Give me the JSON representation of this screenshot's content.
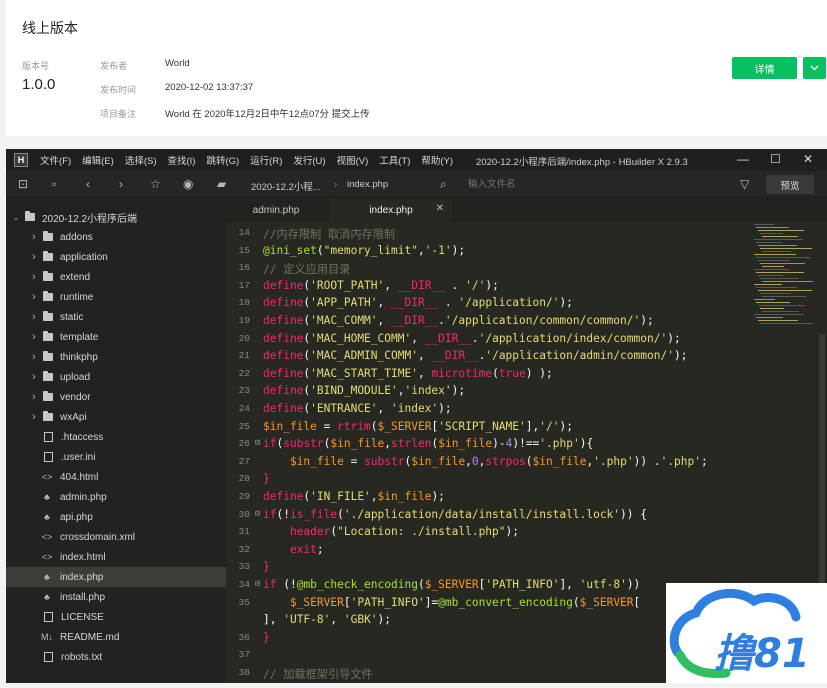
{
  "card": {
    "title": "线上版本",
    "version_label": "版本号",
    "version": "1.0.0",
    "publisher_label": "发布者",
    "publisher": "World",
    "time_label": "发布时间",
    "time": "2020-12-02 13:37:37",
    "note_label": "项目备注",
    "note": "World 在 2020年12月2日中午12点07分 提交上传",
    "detail_button": "详情"
  },
  "editor": {
    "menu": [
      "文件(F)",
      "编辑(E)",
      "选择(S)",
      "查找(I)",
      "跳转(G)",
      "运行(R)",
      "发行(U)",
      "视图(V)",
      "工具(T)",
      "帮助(Y)"
    ],
    "window_title": "2020-12.2小程序后端/index.php - HBuilder X 2.9.3",
    "breadcrumb": [
      "2020-12.2小程...",
      "index.php"
    ],
    "search_placeholder": "输入文件名",
    "preview_button": "预览",
    "tabs": [
      "admin.php",
      "index.php"
    ],
    "project": "2020-12.2小程序后端",
    "tree": [
      {
        "name": "addons",
        "type": "folder"
      },
      {
        "name": "application",
        "type": "folder"
      },
      {
        "name": "extend",
        "type": "folder"
      },
      {
        "name": "runtime",
        "type": "folder"
      },
      {
        "name": "static",
        "type": "folder"
      },
      {
        "name": "template",
        "type": "folder"
      },
      {
        "name": "thinkphp",
        "type": "folder"
      },
      {
        "name": "upload",
        "type": "folder"
      },
      {
        "name": "vendor",
        "type": "folder"
      },
      {
        "name": "wxApi",
        "type": "folder"
      },
      {
        "name": ".htaccess",
        "type": "file"
      },
      {
        "name": ".user.ini",
        "type": "file"
      },
      {
        "name": "404.html",
        "type": "html"
      },
      {
        "name": "admin.php",
        "type": "php"
      },
      {
        "name": "api.php",
        "type": "php"
      },
      {
        "name": "crossdomain.xml",
        "type": "html"
      },
      {
        "name": "index.html",
        "type": "html"
      },
      {
        "name": "index.php",
        "type": "php"
      },
      {
        "name": "install.php",
        "type": "php"
      },
      {
        "name": "LICENSE",
        "type": "file"
      },
      {
        "name": "README.md",
        "type": "md"
      },
      {
        "name": "robots.txt",
        "type": "file"
      }
    ],
    "selected_file": "index.php",
    "code_lines": [
      {
        "n": "14",
        "tokens": [
          [
            "c",
            "//内存限制 取消内存限制"
          ]
        ]
      },
      {
        "n": "15",
        "tokens": [
          [
            "f",
            "@ini_set"
          ],
          [
            "p",
            "("
          ],
          [
            "s",
            "\"memory_limit\""
          ],
          [
            "p",
            ","
          ],
          [
            "s",
            "'-1'"
          ],
          [
            "p",
            ");"
          ]
        ]
      },
      {
        "n": "16",
        "tokens": [
          [
            "c",
            "// 定义应用目录"
          ]
        ]
      },
      {
        "n": "17",
        "tokens": [
          [
            "k",
            "define"
          ],
          [
            "p",
            "("
          ],
          [
            "s",
            "'ROOT_PATH'"
          ],
          [
            "p",
            ", "
          ],
          [
            "k",
            "__DIR__"
          ],
          [
            "p",
            " . "
          ],
          [
            "s",
            "'/'"
          ],
          [
            "p",
            ");"
          ]
        ]
      },
      {
        "n": "18",
        "tokens": [
          [
            "k",
            "define"
          ],
          [
            "p",
            "("
          ],
          [
            "s",
            "'APP_PATH'"
          ],
          [
            "p",
            ", "
          ],
          [
            "k",
            "__DIR__"
          ],
          [
            "p",
            " . "
          ],
          [
            "s",
            "'/application/'"
          ],
          [
            "p",
            ");"
          ]
        ]
      },
      {
        "n": "19",
        "tokens": [
          [
            "k",
            "define"
          ],
          [
            "p",
            "("
          ],
          [
            "s",
            "'MAC_COMM'"
          ],
          [
            "p",
            ", "
          ],
          [
            "k",
            "__DIR__"
          ],
          [
            "p",
            "."
          ],
          [
            "s",
            "'/application/common/common/'"
          ],
          [
            "p",
            ");"
          ]
        ]
      },
      {
        "n": "20",
        "tokens": [
          [
            "k",
            "define"
          ],
          [
            "p",
            "("
          ],
          [
            "s",
            "'MAC_HOME_COMM'"
          ],
          [
            "p",
            ", "
          ],
          [
            "k",
            "__DIR__"
          ],
          [
            "p",
            "."
          ],
          [
            "s",
            "'/application/index/common/'"
          ],
          [
            "p",
            ");"
          ]
        ]
      },
      {
        "n": "21",
        "tokens": [
          [
            "k",
            "define"
          ],
          [
            "p",
            "("
          ],
          [
            "s",
            "'MAC_ADMIN_COMM'"
          ],
          [
            "p",
            ", "
          ],
          [
            "k",
            "__DIR__"
          ],
          [
            "p",
            "."
          ],
          [
            "s",
            "'/application/admin/common/'"
          ],
          [
            "p",
            ");"
          ]
        ]
      },
      {
        "n": "22",
        "tokens": [
          [
            "k",
            "define"
          ],
          [
            "p",
            "("
          ],
          [
            "s",
            "'MAC_START_TIME'"
          ],
          [
            "p",
            ", "
          ],
          [
            "k",
            "microtime"
          ],
          [
            "p",
            "("
          ],
          [
            "k",
            "true"
          ],
          [
            "p",
            ") );"
          ]
        ]
      },
      {
        "n": "23",
        "tokens": [
          [
            "k",
            "define"
          ],
          [
            "p",
            "("
          ],
          [
            "s",
            "'BIND_MODULE'"
          ],
          [
            "p",
            ","
          ],
          [
            "s",
            "'index'"
          ],
          [
            "p",
            ");"
          ]
        ]
      },
      {
        "n": "24",
        "tokens": [
          [
            "k",
            "define"
          ],
          [
            "p",
            "("
          ],
          [
            "s",
            "'ENTRANCE'"
          ],
          [
            "p",
            ", "
          ],
          [
            "s",
            "'index'"
          ],
          [
            "p",
            ");"
          ]
        ]
      },
      {
        "n": "25",
        "tokens": [
          [
            "v",
            "$in_file"
          ],
          [
            "p",
            " = "
          ],
          [
            "k",
            "rtrim"
          ],
          [
            "p",
            "("
          ],
          [
            "v",
            "$_SERVER"
          ],
          [
            "p",
            "["
          ],
          [
            "s",
            "'SCRIPT_NAME'"
          ],
          [
            "p",
            "],"
          ],
          [
            "s",
            "'/'"
          ],
          [
            "p",
            ");"
          ]
        ]
      },
      {
        "n": "26",
        "fold": "⊟",
        "tokens": [
          [
            "k",
            "if"
          ],
          [
            "p",
            "("
          ],
          [
            "k",
            "substr"
          ],
          [
            "p",
            "("
          ],
          [
            "v",
            "$in_file"
          ],
          [
            "p",
            ","
          ],
          [
            "k",
            "strlen"
          ],
          [
            "p",
            "("
          ],
          [
            "v",
            "$in_file"
          ],
          [
            "p",
            ")-"
          ],
          [
            "n",
            "4"
          ],
          [
            "p",
            ")!=="
          ],
          [
            "s",
            "'.php'"
          ],
          [
            "p",
            "){"
          ]
        ]
      },
      {
        "n": "27",
        "tokens": [
          [
            "p",
            "    "
          ],
          [
            "v",
            "$in_file"
          ],
          [
            "p",
            " = "
          ],
          [
            "k",
            "substr"
          ],
          [
            "p",
            "("
          ],
          [
            "v",
            "$in_file"
          ],
          [
            "p",
            ","
          ],
          [
            "n",
            "0"
          ],
          [
            "p",
            ","
          ],
          [
            "k",
            "strpos"
          ],
          [
            "p",
            "("
          ],
          [
            "v",
            "$in_file"
          ],
          [
            "p",
            ","
          ],
          [
            "s",
            "'.php'"
          ],
          [
            "p",
            ")) ."
          ],
          [
            "s",
            "'.php'"
          ],
          [
            "p",
            ";"
          ]
        ]
      },
      {
        "n": "28",
        "tokens": [
          [
            "k",
            "}"
          ]
        ]
      },
      {
        "n": "29",
        "tokens": [
          [
            "k",
            "define"
          ],
          [
            "p",
            "("
          ],
          [
            "s",
            "'IN_FILE'"
          ],
          [
            "p",
            ","
          ],
          [
            "v",
            "$in_file"
          ],
          [
            "p",
            ");"
          ]
        ]
      },
      {
        "n": "30",
        "fold": "⊟",
        "tokens": [
          [
            "k",
            "if"
          ],
          [
            "p",
            "(!"
          ],
          [
            "k",
            "is_file"
          ],
          [
            "p",
            "("
          ],
          [
            "s",
            "'./application/data/install/install.lock'"
          ],
          [
            "p",
            ")) {"
          ]
        ]
      },
      {
        "n": "31",
        "tokens": [
          [
            "p",
            "    "
          ],
          [
            "k",
            "header"
          ],
          [
            "p",
            "("
          ],
          [
            "s",
            "\"Location: ./install.php\""
          ],
          [
            "p",
            ");"
          ]
        ]
      },
      {
        "n": "32",
        "tokens": [
          [
            "p",
            "    "
          ],
          [
            "k",
            "exit"
          ],
          [
            "p",
            ";"
          ]
        ]
      },
      {
        "n": "33",
        "tokens": [
          [
            "k",
            "}"
          ]
        ]
      },
      {
        "n": "34",
        "fold": "⊟",
        "tokens": [
          [
            "k",
            "if"
          ],
          [
            "p",
            " (!"
          ],
          [
            "f",
            "@mb_check_encoding"
          ],
          [
            "p",
            "("
          ],
          [
            "v",
            "$_SERVER"
          ],
          [
            "p",
            "["
          ],
          [
            "s",
            "'PATH_INFO'"
          ],
          [
            "p",
            "], "
          ],
          [
            "s",
            "'utf-8'"
          ],
          [
            "p",
            "))"
          ]
        ]
      },
      {
        "n": "35",
        "tokens": [
          [
            "p",
            "    "
          ],
          [
            "v",
            "$_SERVER"
          ],
          [
            "p",
            "["
          ],
          [
            "s",
            "'PATH_INFO'"
          ],
          [
            "p",
            "]="
          ],
          [
            "f",
            "@mb_convert_encoding"
          ],
          [
            "p",
            "("
          ],
          [
            "v",
            "$_SERVER"
          ],
          [
            "p",
            "["
          ]
        ]
      },
      {
        "n": "",
        "tokens": [
          [
            "p",
            "], "
          ],
          [
            "s",
            "'UTF-8'"
          ],
          [
            "p",
            ", "
          ],
          [
            "s",
            "'GBK'"
          ],
          [
            "p",
            ");"
          ]
        ]
      },
      {
        "n": "36",
        "tokens": [
          [
            "k",
            "}"
          ]
        ]
      },
      {
        "n": "37",
        "tokens": []
      },
      {
        "n": "38",
        "tokens": [
          [
            "c",
            "// 加载框架引导文件"
          ]
        ]
      }
    ]
  },
  "colors": {
    "accent": "#07c160",
    "editor_bg": "#272822",
    "sidebar_bg": "#22221f",
    "watermark": "#1e88e5"
  },
  "watermark": {
    "text": "撸81"
  }
}
